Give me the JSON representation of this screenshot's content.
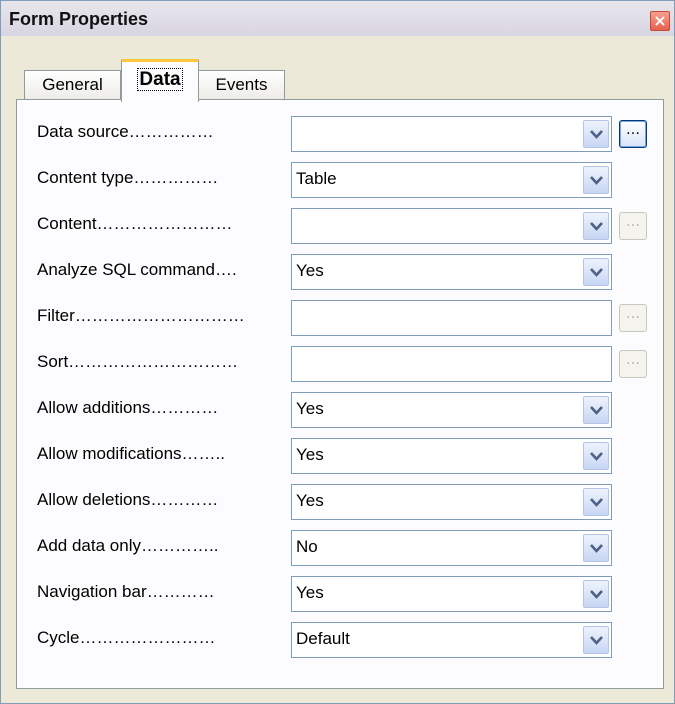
{
  "window": {
    "title": "Form Properties",
    "close_label": "×"
  },
  "tabs": [
    {
      "label": "General",
      "active": false
    },
    {
      "label": "Data",
      "active": true
    },
    {
      "label": "Events",
      "active": false
    }
  ],
  "properties": {
    "data_source": {
      "label": "Data source……………",
      "value": "",
      "ellipsis": "…"
    },
    "content_type": {
      "label": "Content type……………",
      "value": "Table"
    },
    "content": {
      "label": "Content……………………",
      "value": "",
      "ellipsis": "…"
    },
    "analyze_sql": {
      "label": "Analyze SQL command….",
      "value": "Yes"
    },
    "filter": {
      "label": "Filter…………………………",
      "value": "",
      "ellipsis": "…"
    },
    "sort": {
      "label": "Sort…………………………",
      "value": "",
      "ellipsis": "…"
    },
    "allow_additions": {
      "label": "Allow additions…………",
      "value": "Yes"
    },
    "allow_modifications": {
      "label": "Allow modifications……..",
      "value": "Yes"
    },
    "allow_deletions": {
      "label": "Allow deletions…………",
      "value": "Yes"
    },
    "add_data_only": {
      "label": "Add data only…………..",
      "value": "No"
    },
    "navigation_bar": {
      "label": "Navigation bar…………",
      "value": "Yes"
    },
    "cycle": {
      "label": "Cycle……………………",
      "value": "Default"
    }
  },
  "icons": {
    "dropdown": "chevron-down-icon",
    "close": "close-icon"
  },
  "colors": {
    "window_bg": "#ece9d8",
    "panel_bg": "#fcfcfe",
    "active_tab_accent": "#ffc83c",
    "close_red": "#e8604c"
  }
}
